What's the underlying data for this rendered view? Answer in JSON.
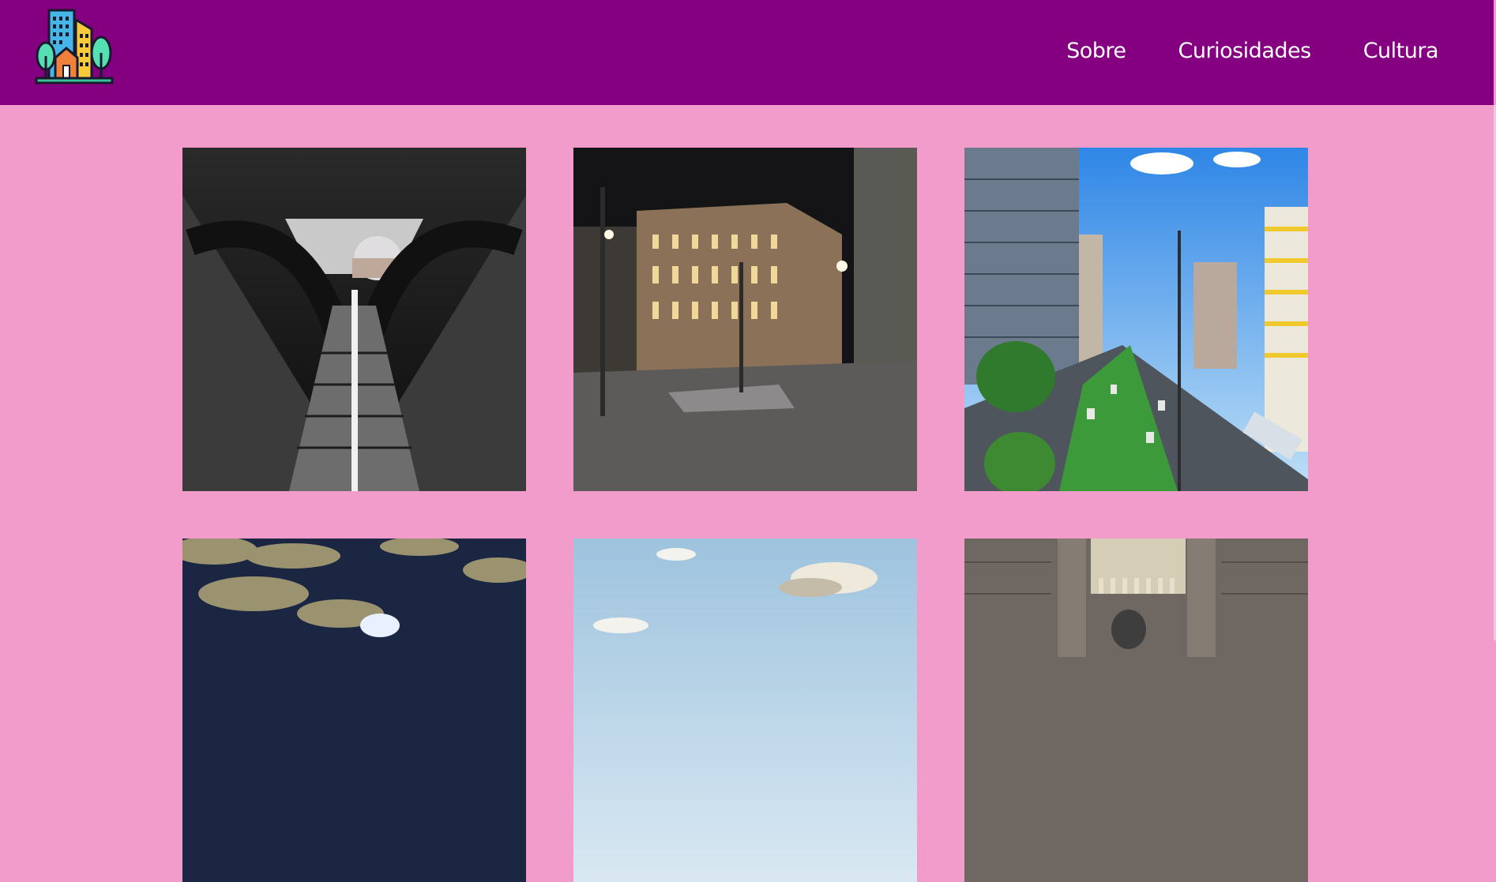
{
  "header": {
    "logo_icon": "city-buildings-trees-logo-icon",
    "background_color": "#850080",
    "nav": [
      {
        "label": "Sobre"
      },
      {
        "label": "Curiosidades"
      },
      {
        "label": "Cultura"
      }
    ]
  },
  "page": {
    "background_color": "#f29ccb"
  },
  "gallery": {
    "items": [
      {
        "subject": "escalator-with-dome-photo"
      },
      {
        "subject": "night-city-square-building-photo"
      },
      {
        "subject": "avenue-traffic-skyscrapers-photo"
      },
      {
        "subject": "cloudy-night-sky-photo"
      },
      {
        "subject": "daytime-sky-clouds-photo"
      },
      {
        "subject": "historic-stone-facade-statue-photo"
      }
    ]
  }
}
